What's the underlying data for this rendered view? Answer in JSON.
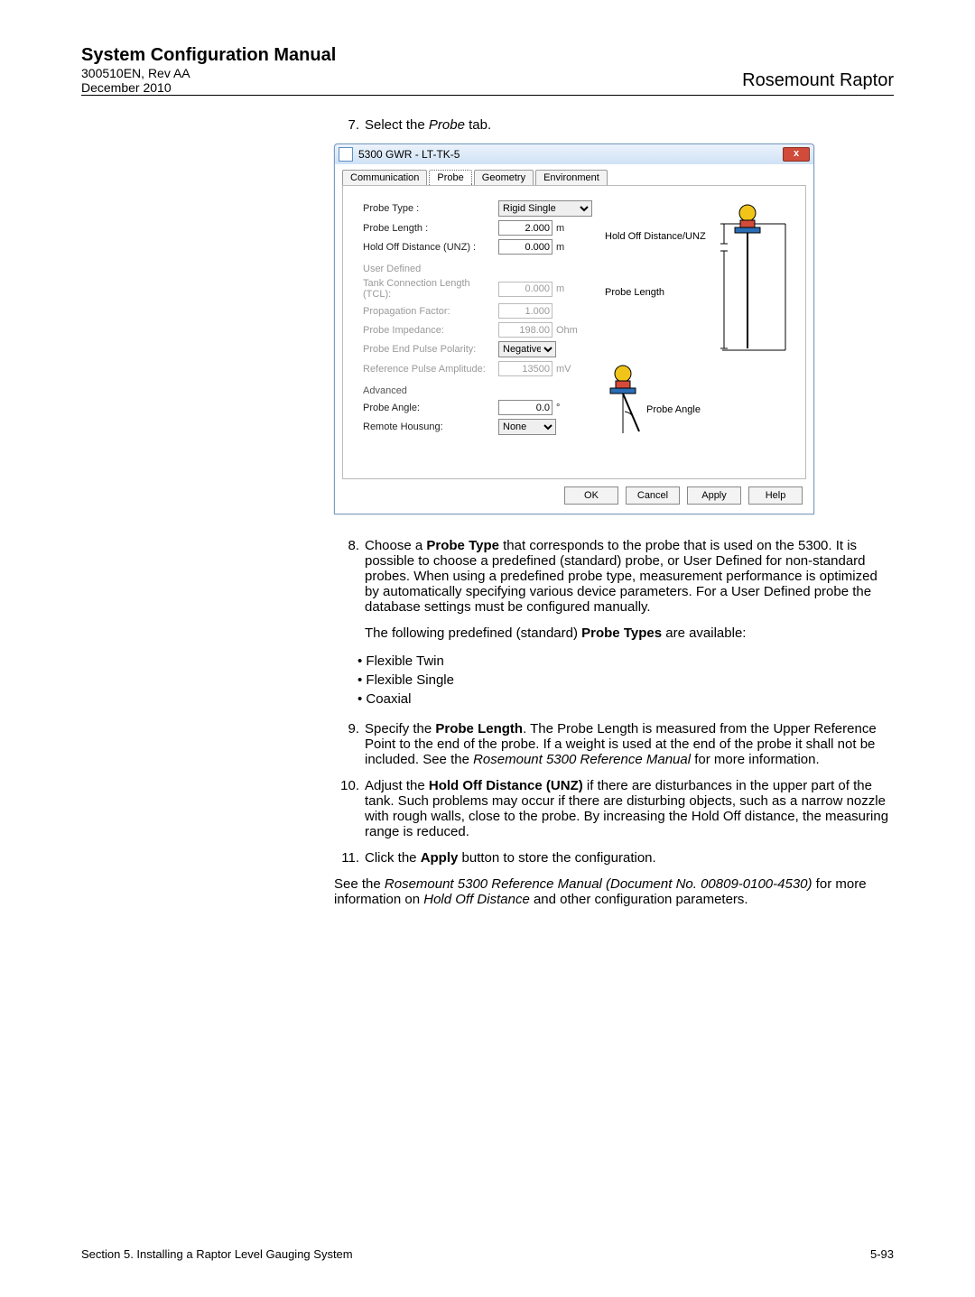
{
  "header": {
    "title": "System Configuration Manual",
    "doc": "300510EN, Rev AA",
    "date": "December 2010",
    "product": "Rosemount Raptor"
  },
  "steps": {
    "s7": "Select the ",
    "s7_it": "Probe",
    "s7_tail": " tab.",
    "s8": "Choose a ",
    "s8_b": "Probe Type",
    "s8_tail": " that corresponds to the probe that is used on the 5300. It is possible to choose a predefined (standard) probe, or User Defined for non-standard probes. When using a predefined probe type, measurement performance is optimized by automatically specifying various device parameters. For a User Defined probe the database settings must be configured manually.",
    "s8_p2a": "The following predefined (standard) ",
    "s8_p2b": "Probe Types",
    "s8_p2c": " are available:",
    "s9": "Specify the ",
    "s9_b": "Probe Length",
    "s9_tail": ". The Probe Length is measured from the Upper Reference Point to the end of the probe. If a weight is used at the end of the probe it shall not be included. See the ",
    "s9_it": "Rosemount 5300 Reference Manual",
    "s9_tail2": " for more information.",
    "s10": "Adjust the ",
    "s10_b": "Hold Off Distance (UNZ)",
    "s10_tail": " if there are disturbances in the upper part of the tank. Such problems may occur if there are disturbing objects, such as a narrow nozzle with rough walls, close to the probe. By increasing the Hold Off distance, the measuring range is reduced.",
    "s11": "Click the ",
    "s11_b": "Apply",
    "s11_tail": " button to store the configuration."
  },
  "bullets": {
    "a": "Flexible Twin",
    "b": "Flexible Single",
    "c": "Coaxial"
  },
  "closing": {
    "a": "See the ",
    "it1": "Rosemount 5300 Reference Manual (Document No. 00809-0100-4530)",
    "b": " for more information on ",
    "it2": "Hold Off Distance",
    "c": " and other configuration parameters."
  },
  "footer": {
    "section": "Section 5. Installing a Raptor Level Gauging System",
    "page": "5-93"
  },
  "dialog": {
    "title": "5300 GWR  - LT-TK-5",
    "close": "x",
    "tabs": {
      "t1": "Communication",
      "t2": "Probe",
      "t3": "Geometry",
      "t4": "Environment"
    },
    "labels": {
      "probeType": "Probe Type :",
      "probeLength": "Probe Length :",
      "holdOff": "Hold Off Distance (UNZ) :",
      "userDefined": "User Defined",
      "tcl": "Tank Connection Length (TCL):",
      "pf": "Propagation Factor:",
      "pi": "Probe Impedance:",
      "pep": "Probe End Pulse Polarity:",
      "rpa": "Reference Pulse Amplitude:",
      "advanced": "Advanced",
      "pa": "Probe Angle:",
      "rh": "Remote Housung:"
    },
    "values": {
      "probeType": "Rigid Single",
      "probeLength": "2.000",
      "holdOff": "0.000",
      "tcl": "0.000",
      "pf": "1.000",
      "pi": "198.00",
      "pep": "Negative",
      "rpa": "13500",
      "pa": "0.0",
      "rh": "None"
    },
    "units": {
      "m": "m",
      "ohm": "Ohm",
      "mv": "mV",
      "deg": "°"
    },
    "diagram": {
      "hold": "Hold Off Distance/UNZ",
      "plen": "Probe Length",
      "pangle": "Probe Angle"
    },
    "buttons": {
      "ok": "OK",
      "cancel": "Cancel",
      "apply": "Apply",
      "help": "Help"
    }
  }
}
